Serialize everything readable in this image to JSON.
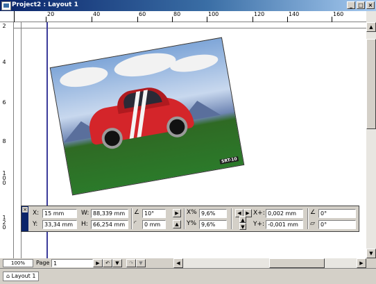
{
  "window": {
    "title": "Project2 : Layout 1",
    "buttons": {
      "minimize": "_",
      "restore": "□",
      "close": "×"
    }
  },
  "rulers": {
    "horizontal_labels": [
      "20",
      "40",
      "60",
      "80",
      "100",
      "120",
      "140",
      "160"
    ],
    "vertical_labels": [
      "2",
      "4",
      "6",
      "8",
      "100",
      "120"
    ]
  },
  "measurements": {
    "x_label": "X:",
    "x_value": "15 mm",
    "y_label": "Y:",
    "y_value": "33,34 mm",
    "w_label": "W:",
    "w_value": "88,339 mm",
    "h_label": "H:",
    "h_value": "66,254 mm",
    "angle_value": "10°",
    "corner_radius_value": "0 mm",
    "scale_x_value": "9,6%",
    "scale_y_value": "9,6%",
    "offset_x_label": "X+:",
    "offset_x_value": "0,002 mm",
    "offset_y_label": "Y+:",
    "offset_y_value": "-0,001 mm",
    "picture_angle_value": "0°",
    "picture_skew_value": "0°"
  },
  "footer": {
    "zoom": "100%",
    "page_label": "Page",
    "page_value": "1",
    "layout_tab": "Layout 1"
  },
  "image": {
    "logo_text": "SRT-10"
  },
  "colors": {
    "title_bar": "#0a246a",
    "guide": "#3b3b9a",
    "car": "#d4252a"
  }
}
